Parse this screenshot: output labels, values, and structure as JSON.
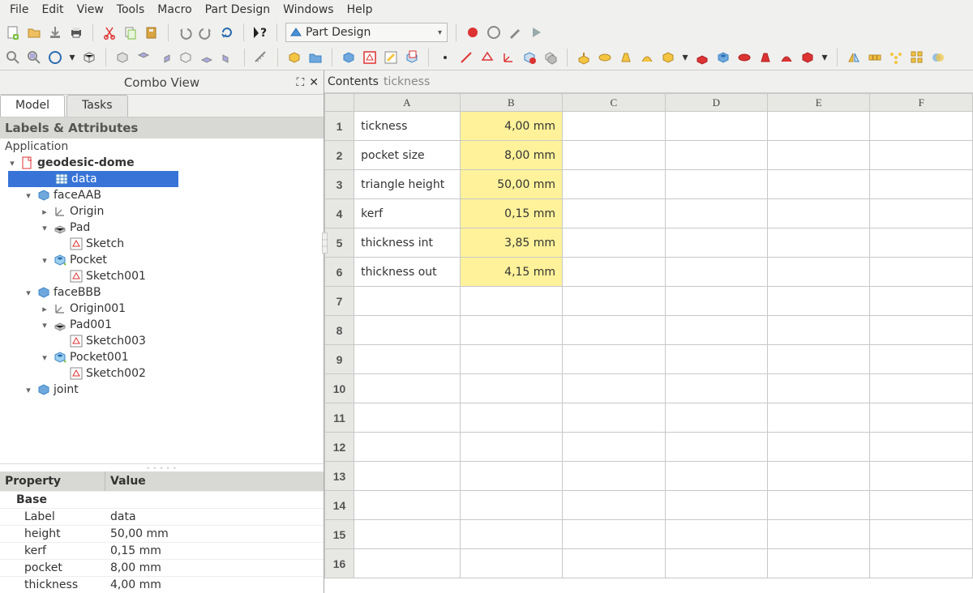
{
  "menu": {
    "items": [
      "File",
      "Edit",
      "View",
      "Tools",
      "Macro",
      "Part Design",
      "Windows",
      "Help"
    ]
  },
  "workbench": {
    "selected": "Part Design"
  },
  "combo": {
    "title": "Combo View",
    "tabs": {
      "model": "Model",
      "tasks": "Tasks"
    },
    "labels_hdr": "Labels & Attributes",
    "app": "Application",
    "tree": [
      {
        "label": "geodesic-dome",
        "indent": 0,
        "icon": "doc",
        "bold": true,
        "exp": "v"
      },
      {
        "label": "data",
        "indent": 1,
        "icon": "sheet",
        "sel": true
      },
      {
        "label": "faceAAB",
        "indent": 1,
        "icon": "body",
        "exp": "v"
      },
      {
        "label": "Origin",
        "indent": 2,
        "icon": "origin",
        "exp": ">"
      },
      {
        "label": "Pad",
        "indent": 2,
        "icon": "pad",
        "exp": "v"
      },
      {
        "label": "Sketch",
        "indent": 3,
        "icon": "sketch"
      },
      {
        "label": "Pocket",
        "indent": 2,
        "icon": "pocket",
        "exp": "v"
      },
      {
        "label": "Sketch001",
        "indent": 3,
        "icon": "sketch"
      },
      {
        "label": "faceBBB",
        "indent": 1,
        "icon": "body",
        "exp": "v"
      },
      {
        "label": "Origin001",
        "indent": 2,
        "icon": "origin",
        "exp": ">"
      },
      {
        "label": "Pad001",
        "indent": 2,
        "icon": "pad",
        "exp": "v"
      },
      {
        "label": "Sketch003",
        "indent": 3,
        "icon": "sketch"
      },
      {
        "label": "Pocket001",
        "indent": 2,
        "icon": "pocket",
        "exp": "v"
      },
      {
        "label": "Sketch002",
        "indent": 3,
        "icon": "sketch"
      },
      {
        "label": "joint",
        "indent": 1,
        "icon": "body",
        "exp": "v",
        "cut": true
      }
    ]
  },
  "props": {
    "hdr_prop": "Property",
    "hdr_val": "Value",
    "base": "Base",
    "rows": [
      {
        "k": "Label",
        "v": "data"
      },
      {
        "k": "height",
        "v": "50,00 mm"
      },
      {
        "k": "kerf",
        "v": "0,15 mm"
      },
      {
        "k": "pocket",
        "v": "8,00 mm"
      },
      {
        "k": "thickness",
        "v": "4,00 mm"
      }
    ]
  },
  "sheet": {
    "contents_label": "Contents",
    "cell_ref": "tickness",
    "cols": [
      "A",
      "B",
      "C",
      "D",
      "E",
      "F"
    ],
    "rows": [
      {
        "a": "tickness",
        "b": "4,00 mm"
      },
      {
        "a": "pocket size",
        "b": "8,00 mm"
      },
      {
        "a": "triangle height",
        "b": "50,00 mm"
      },
      {
        "a": "kerf",
        "b": "0,15 mm"
      },
      {
        "a": "thickness int",
        "b": "3,85 mm"
      },
      {
        "a": "thickness out",
        "b": "4,15 mm"
      }
    ],
    "total_rows": 16
  }
}
